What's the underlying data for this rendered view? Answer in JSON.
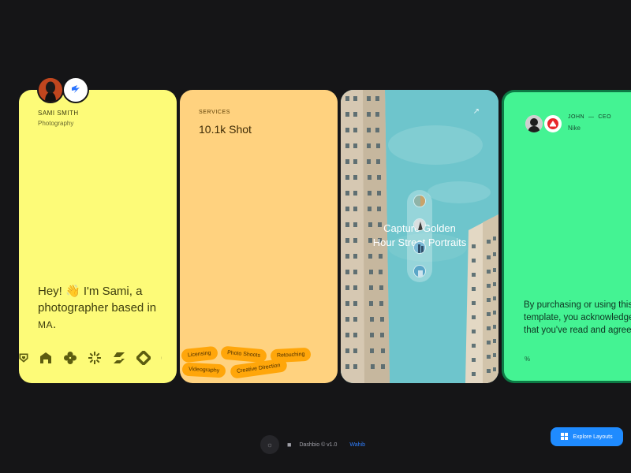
{
  "profile": {
    "name": "SAMI SMITH",
    "role": "Photography",
    "bio_prefix": "Hey! ",
    "wave": "👋",
    "bio_suffix": " I'm Sami, a photographer based in ",
    "location": "MA",
    "bio_end": ".",
    "avatar_icon": "person-portrait-icon",
    "badge_icon": "framer-logo-icon"
  },
  "services": {
    "label": "SERVICES",
    "stat": "10.1k Shot",
    "tags": [
      "Licensing",
      "Photo Shoots",
      "Retouching",
      "Videography",
      "Creative Direction"
    ]
  },
  "portfolio": {
    "headline_line1": "Capture Golden",
    "headline_line2": "Hour Street Portraits",
    "arrow": "↗",
    "colors": {
      "sky": "#6ec5cc",
      "building": "#d8cbb6"
    }
  },
  "testimonial": {
    "who": "JOHN",
    "dash": "—",
    "title": "CEO",
    "company": "Nike",
    "text": "By purchasing or using this template, you acknowledge that you've read and agree.",
    "link": "%"
  },
  "footer": {
    "brand": "Dashbio © v1.0",
    "author": "Wahib",
    "explore": "Explore Layouts"
  },
  "colors": {
    "yellow": "#fdfb78",
    "orange": "#ffd27f",
    "green": "#44f393",
    "accent_blue": "#1f8bff"
  }
}
